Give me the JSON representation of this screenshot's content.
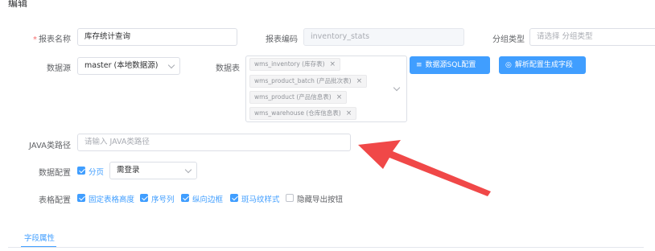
{
  "header": {
    "title": "编辑"
  },
  "form": {
    "report_name": {
      "label": "报表名称",
      "required_mark": "*",
      "value": "库存统计查询"
    },
    "report_code": {
      "label": "报表编码",
      "value": "inventory_stats"
    },
    "group_type": {
      "label": "分组类型",
      "placeholder": "请选择 分组类型"
    },
    "datasource": {
      "label": "数据源",
      "value": "master (本地数据源)"
    },
    "datatable": {
      "label": "数据表",
      "tags": [
        "wms_inventory (库存表)",
        "wms_product_batch (产品批次表)",
        "wms_product (产品信息表)",
        "wms_warehouse (仓库信息表)"
      ],
      "tag_close": "×"
    },
    "buttons": {
      "sql_config": {
        "icon": "≡",
        "label": "数据源SQL配置"
      },
      "parse_config": {
        "icon": "◎",
        "label": "解析配置生成字段"
      }
    },
    "java_path": {
      "label": "JAVA类路径",
      "placeholder": "请输入 JAVA类路径"
    },
    "data_config": {
      "label": "数据配置",
      "paging": {
        "label": "分页",
        "checked": true
      },
      "login_select": {
        "value": "需登录"
      }
    },
    "table_config": {
      "label": "表格配置",
      "options": [
        {
          "label": "固定表格高度",
          "checked": true
        },
        {
          "label": "序号列",
          "checked": true
        },
        {
          "label": "纵向边框",
          "checked": true
        },
        {
          "label": "斑马纹样式",
          "checked": true
        },
        {
          "label": "隐藏导出按钮",
          "checked": false
        }
      ]
    }
  },
  "tabs": [
    {
      "label": "字段属性",
      "active": true
    }
  ],
  "annotation": {
    "color": "#f04848",
    "icon": "arrow-annotation"
  },
  "colors": {
    "primary": "#409eff",
    "required": "#f56c6c"
  }
}
